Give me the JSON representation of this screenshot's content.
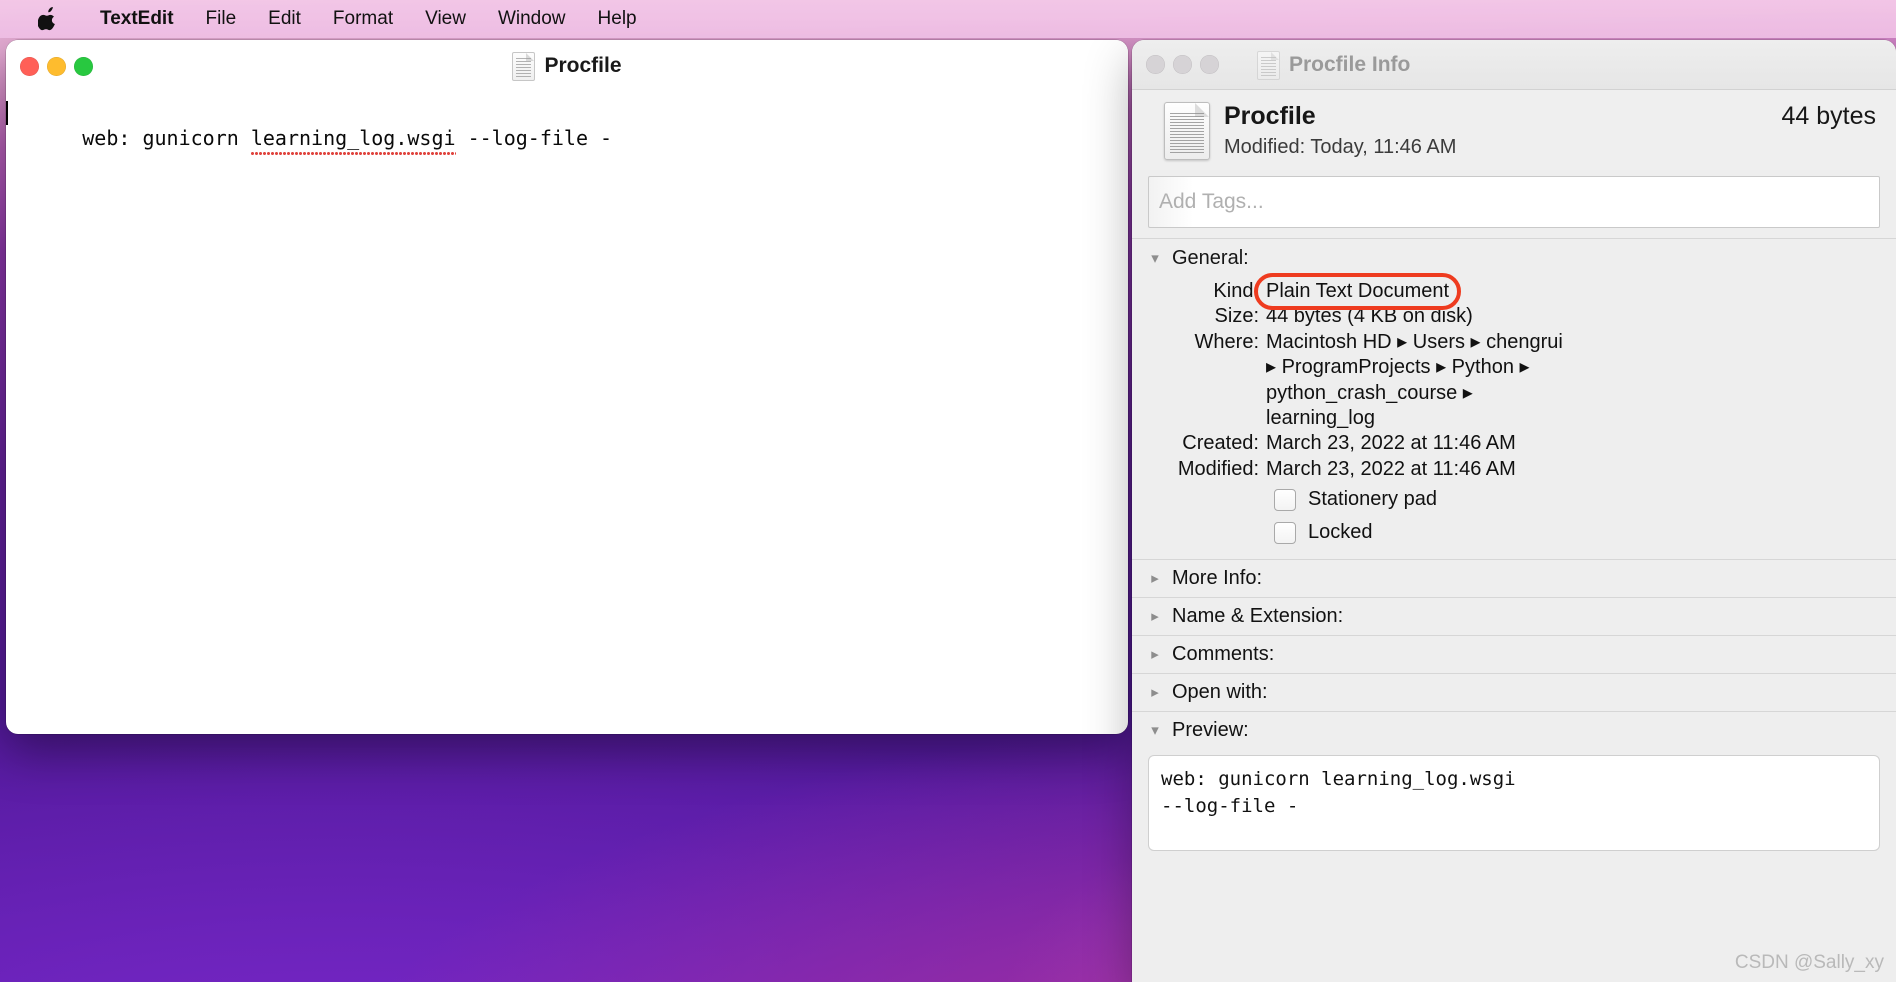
{
  "menubar": {
    "apple_icon": "apple-logo-icon",
    "items": [
      {
        "label": "TextEdit",
        "bold": true
      },
      {
        "label": "File"
      },
      {
        "label": "Edit"
      },
      {
        "label": "Format"
      },
      {
        "label": "View"
      },
      {
        "label": "Window"
      },
      {
        "label": "Help"
      }
    ]
  },
  "textedit": {
    "title": "Procfile",
    "document_text_prefix": "web: gunicorn ",
    "document_text_spelled": "learning_log.wsgi",
    "document_text_suffix": " --log-file -"
  },
  "info": {
    "title": "Procfile Info",
    "file_name": "Procfile",
    "file_size": "44 bytes",
    "modified_short": "Modified: Today, 11:46 AM",
    "tags_placeholder": "Add Tags...",
    "general": {
      "heading": "General:",
      "kind_label": "Kind:",
      "kind_value": "Plain Text Document",
      "size_label": "Size:",
      "size_value": "44 bytes (4 KB on disk)",
      "where_label": "Where:",
      "where_line1": "Macintosh HD ▸ Users ▸ chengrui",
      "where_line2": "▸ ProgramProjects ▸ Python ▸",
      "where_line3": "python_crash_course ▸",
      "where_line4": "learning_log",
      "created_label": "Created:",
      "created_value": "March 23, 2022 at 11:46 AM",
      "modified_label": "Modified:",
      "modified_value": "March 23, 2022 at 11:46 AM",
      "stationery_label": "Stationery pad",
      "locked_label": "Locked"
    },
    "sections": [
      {
        "label": "More Info:",
        "expanded": false
      },
      {
        "label": "Name & Extension:",
        "expanded": false
      },
      {
        "label": "Comments:",
        "expanded": false
      },
      {
        "label": "Open with:",
        "expanded": false
      }
    ],
    "preview": {
      "heading": "Preview:",
      "content": "web: gunicorn learning_log.wsgi\n--log-file -"
    }
  },
  "watermark": "CSDN @Sally_xy",
  "colors": {
    "annotation_red": "#ee3b1f",
    "traffic_close": "#ff5f57",
    "traffic_min": "#febc2e",
    "traffic_max": "#28c840"
  }
}
